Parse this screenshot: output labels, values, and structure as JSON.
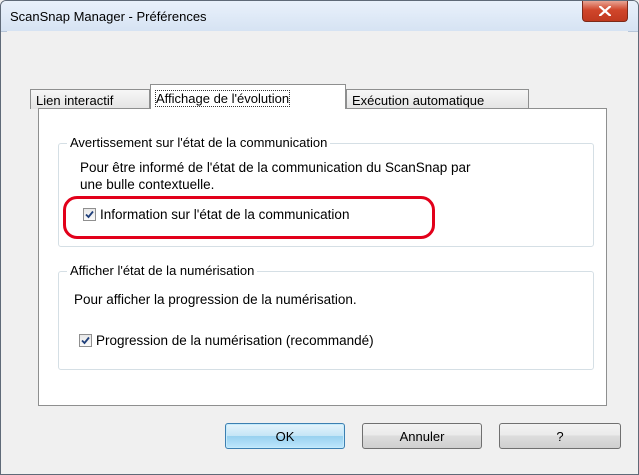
{
  "window": {
    "title": "ScanSnap Manager - Préférences"
  },
  "tabs": [
    {
      "label": "Lien interactif"
    },
    {
      "label": "Affichage de l'évolution"
    },
    {
      "label": "Exécution automatique"
    }
  ],
  "active_tab": "Affichage de l'évolution",
  "group_communication": {
    "title": "Avertissement sur l'état de la communication",
    "desc_line1": "Pour être informé de l'état de la communication du ScanSnap par",
    "desc_line2": "une bulle contextuelle.",
    "checkbox_label": "Information sur l'état de la communication",
    "checked": true
  },
  "group_scan": {
    "title": "Afficher l'état de la numérisation",
    "desc": "Pour afficher la progression de la numérisation.",
    "checkbox_label": "Progression de la numérisation (recommandé)",
    "checked": true
  },
  "buttons": {
    "ok": "OK",
    "cancel": "Annuler",
    "help": "?"
  },
  "colors": {
    "highlight": "#e2001a",
    "close_button": "#c7432a"
  }
}
